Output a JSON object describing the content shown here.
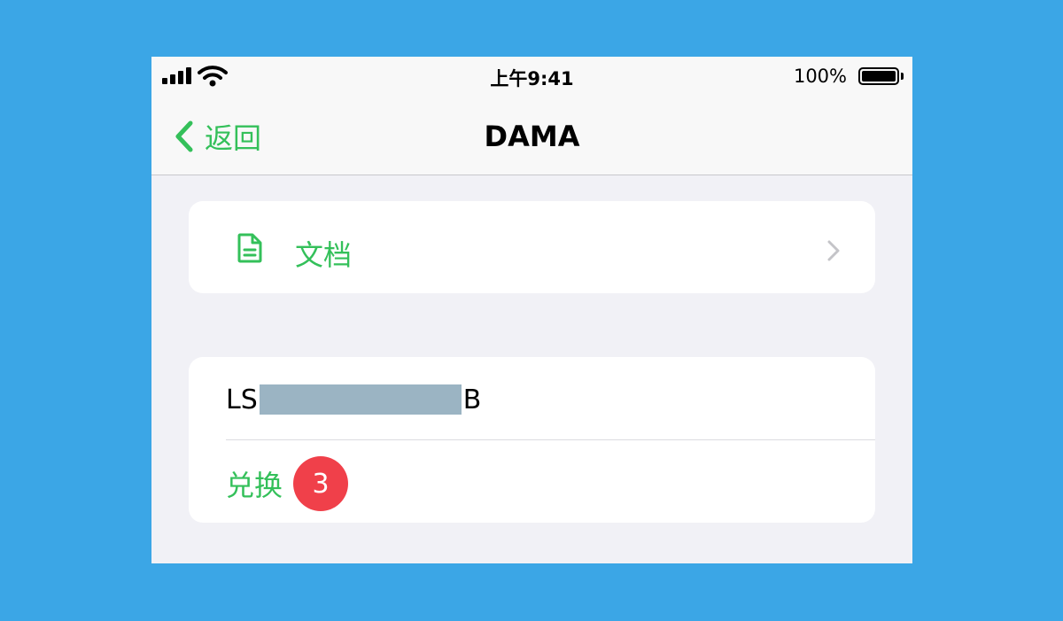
{
  "status_bar": {
    "time": "上午9:41",
    "battery_percent": "100%"
  },
  "nav": {
    "back_label": "返回",
    "title": "DAMA"
  },
  "documents_row": {
    "label": "文档",
    "icon": "document-icon"
  },
  "code_row": {
    "prefix": "LS",
    "suffix": "B"
  },
  "redeem_row": {
    "label": "兑换",
    "badge": "3"
  },
  "colors": {
    "accent": "#34c05a",
    "badge": "#f0404a",
    "background": "#3ba6e6",
    "redaction": "#9bb4c3"
  }
}
